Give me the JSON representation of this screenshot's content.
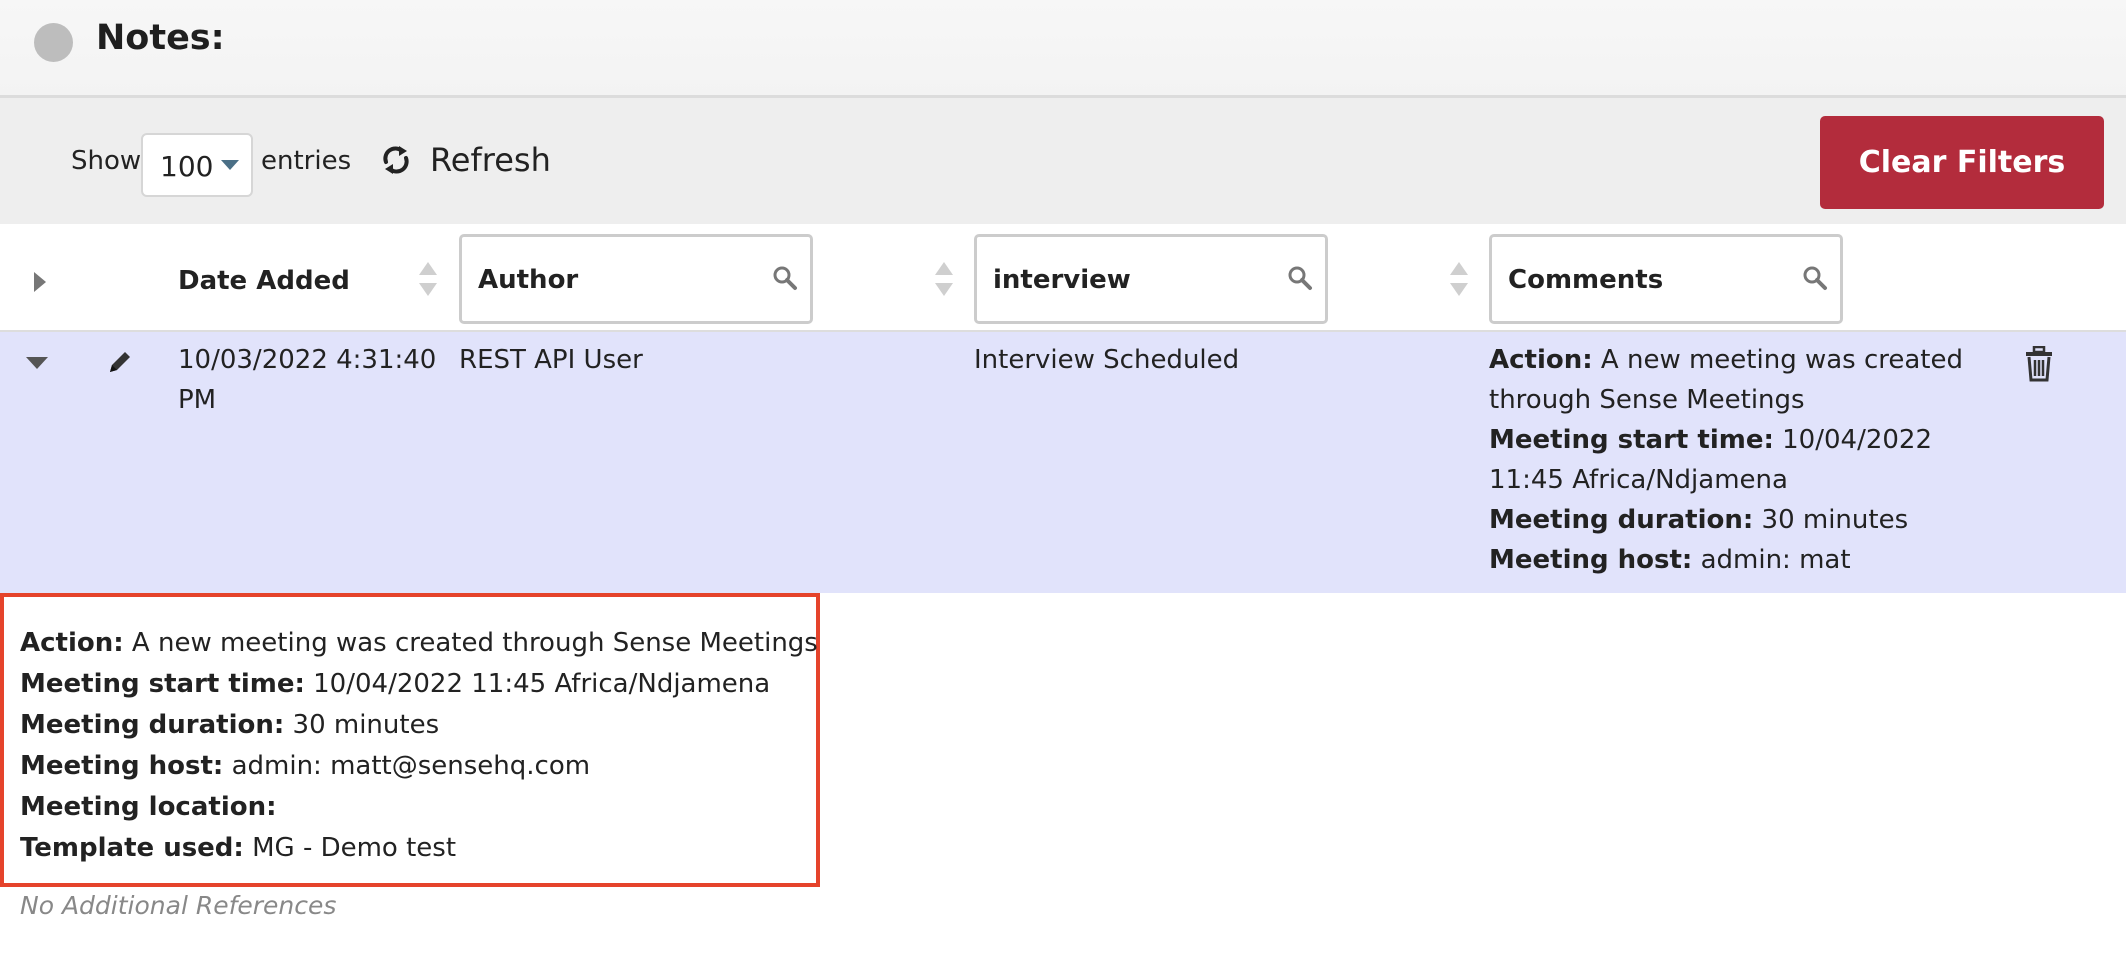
{
  "notes": {
    "title": "Notes:"
  },
  "toolbar": {
    "show_label": "Show",
    "entries_value": "100",
    "entries_label": "entries",
    "refresh_label": "Refresh",
    "clear_filters_label": "Clear Filters"
  },
  "table": {
    "columns": {
      "date_added": "Date Added",
      "author_filter": "Author",
      "interview_filter": "interview",
      "comments_filter": "Comments"
    },
    "row": {
      "date_added": "10/03/2022 4:31:40 PM",
      "author": "REST API User",
      "interview": "Interview Scheduled",
      "comments": [
        {
          "label": "Action:",
          "value": " A new meeting was created through Sense Meetings"
        },
        {
          "label": "Meeting start time:",
          "value": " 10/04/2022 11:45 Africa/Ndjamena"
        },
        {
          "label": "Meeting duration:",
          "value": " 30 minutes"
        },
        {
          "label": "Meeting host:",
          "value": " admin: mat"
        }
      ]
    }
  },
  "detail": {
    "lines": [
      {
        "label": "Action:",
        "value": " A new meeting was created through Sense Meetings"
      },
      {
        "label": "Meeting start time:",
        "value": " 10/04/2022 11:45 Africa/Ndjamena"
      },
      {
        "label": "Meeting duration:",
        "value": " 30 minutes"
      },
      {
        "label": "Meeting host:",
        "value": " admin: matt@sensehq.com"
      },
      {
        "label": "Meeting location:",
        "value": ""
      },
      {
        "label": "Template used:",
        "value": " MG - Demo test"
      }
    ],
    "no_refs": "No Additional References"
  },
  "colors": {
    "clear_filters_bg": "#b32c3c",
    "selected_row_bg": "#e1e3fb",
    "detail_border": "#e5432b"
  },
  "icons": {
    "status": "status-dot-icon",
    "refresh": "refresh-icon",
    "search": "search-icon",
    "edit": "pencil-icon",
    "delete": "trash-icon",
    "expand": "chevron-right-icon",
    "collapse": "chevron-down-icon",
    "sort": "sort-icon"
  }
}
